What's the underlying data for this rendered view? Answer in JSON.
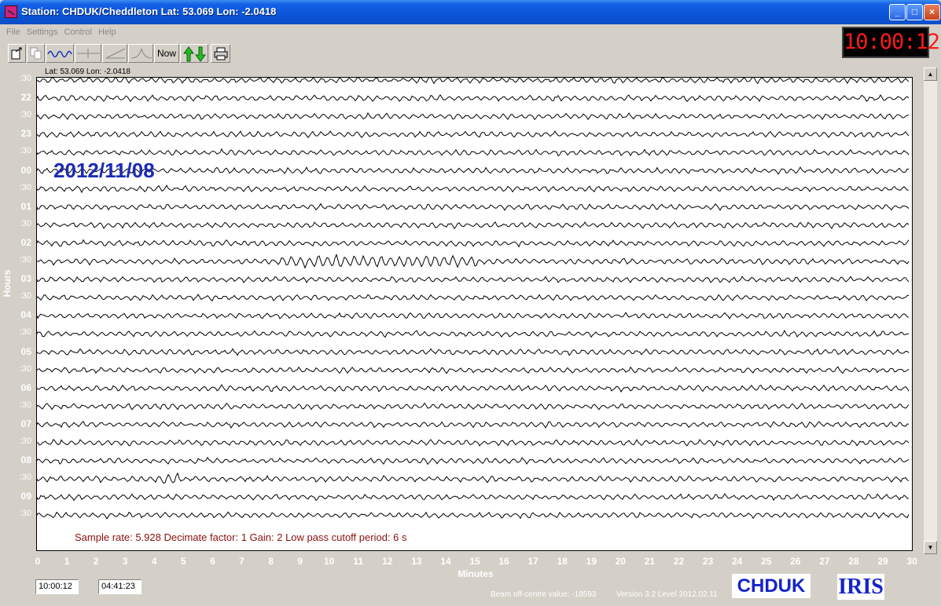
{
  "window": {
    "title": "Station: CHDUK/Cheddleton Lat: 53.069 Lon: -2.0418"
  },
  "menu": [
    "File",
    "Settings",
    "Control",
    "Help"
  ],
  "toolbar": {
    "now_label": "Now"
  },
  "clock": "10:00:12",
  "plot": {
    "latlon": "Lat: 53.069 Lon: -2.0418",
    "date": "2012/11/08",
    "sample_info": "Sample rate: 5.928  Decimate factor: 1  Gain: 2  Low pass cutoff period: 6 s",
    "y_label": "Hours",
    "x_label": "Minutes",
    "hour_labels": [
      ":30",
      "22",
      ":30",
      "23",
      ":30",
      "00",
      ":30",
      "01",
      ":30",
      "02",
      ":30",
      "03",
      ":30",
      "04",
      ":30",
      "05",
      ":30",
      "06",
      ":30",
      "07",
      ":30",
      "08",
      ":30",
      "09",
      ":30"
    ],
    "x_ticks": [
      "0",
      "1",
      "2",
      "3",
      "4",
      "5",
      "6",
      "7",
      "8",
      "9",
      "10",
      "11",
      "12",
      "13",
      "14",
      "15",
      "16",
      "17",
      "18",
      "19",
      "20",
      "21",
      "22",
      "23",
      "24",
      "25",
      "26",
      "27",
      "28",
      "29",
      "30"
    ]
  },
  "status": {
    "time_value": "10:00:12",
    "duration_value": "04:41:23",
    "beam": "Beam off-centre value: -18593",
    "version": "Version 3.2 Level 2012.02.11",
    "station_logo": "CHDUK",
    "iris_logo": "IRIS"
  },
  "colors": {
    "date": "#1c2bb8",
    "sample_info": "#8b1010",
    "clock": "#ff1a1a",
    "titlebar": "#0a54d8"
  }
}
